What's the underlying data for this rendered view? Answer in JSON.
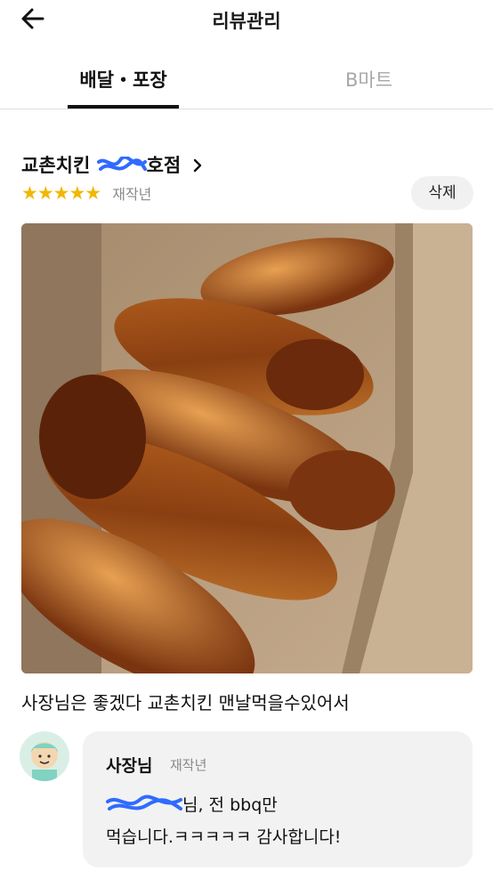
{
  "header": {
    "title": "리뷰관리",
    "back_icon": "arrow-left-icon"
  },
  "tabs": [
    {
      "label": "배달・포장",
      "active": true
    },
    {
      "label": "B마트",
      "active": false
    }
  ],
  "review": {
    "store_name_suffix": "호점",
    "store_name_prefix": "교촌치킨",
    "rating_stars": "★★★★★",
    "rating": 5,
    "date": "재작년",
    "delete_label": "삭제",
    "text": "사장님은 좋겠다 교촌치킨 맨날먹을수있어서"
  },
  "reply": {
    "author": "사장님",
    "date": "재작년",
    "line1_suffix": "님, 전 bbq만",
    "line2": "먹습니다.ㅋㅋㅋㅋㅋ 감사합니다!"
  },
  "colors": {
    "star": "#f2b705",
    "scribble": "#2f6bff",
    "muted": "#8a8a8a",
    "reply_bg": "#f2f2f2"
  }
}
